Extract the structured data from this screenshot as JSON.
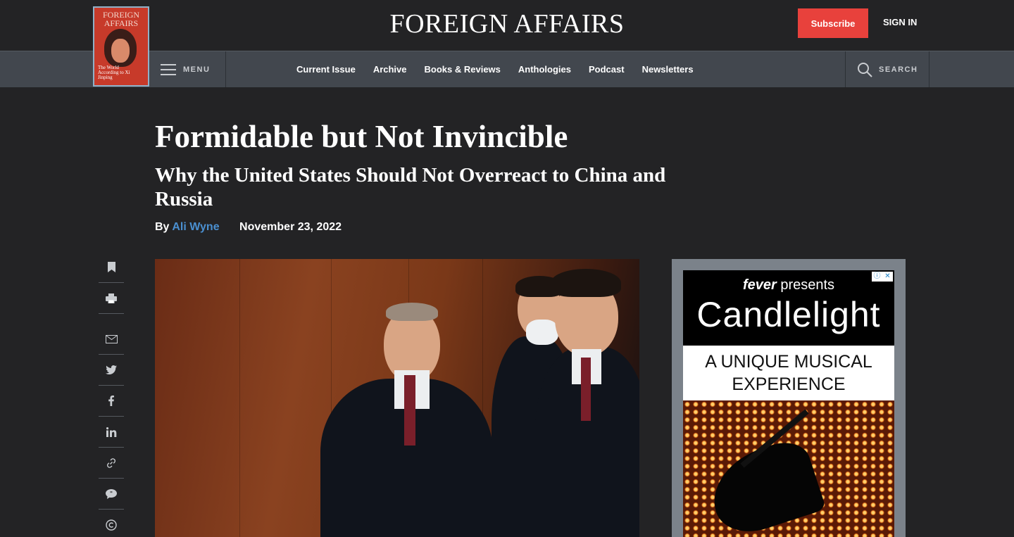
{
  "header": {
    "logo": "FOREIGN AFFAIRS",
    "subscribe_label": "Subscribe",
    "signin_label": "SIGN IN"
  },
  "cover": {
    "title_line1": "FOREIGN",
    "title_line2": "AFFAIRS",
    "subtitle": "The World According to Xi Jinping"
  },
  "nav": {
    "menu_label": "MENU",
    "links": [
      "Current Issue",
      "Archive",
      "Books & Reviews",
      "Anthologies",
      "Podcast",
      "Newsletters"
    ],
    "search_label": "SEARCH"
  },
  "article": {
    "title": "Formidable but Not Invincible",
    "subtitle": "Why the United States Should Not Overreact to China and Russia",
    "by": "By",
    "author": "Ali Wyne",
    "date": "November 23, 2022"
  },
  "share_rail": {
    "icons": [
      "bookmark-icon",
      "print-icon",
      "email-icon",
      "twitter-icon",
      "facebook-icon",
      "linkedin-icon",
      "link-icon",
      "comment-icon",
      "copyright-icon"
    ]
  },
  "ad": {
    "brand": "fever",
    "presents": "presents",
    "headline": "Candlelight",
    "tagline_line1": "A UNIQUE MUSICAL",
    "tagline_line2": "EXPERIENCE",
    "info_glyph": "ⓘ",
    "close_glyph": "✕"
  },
  "colors": {
    "background": "#232325",
    "nav_background": "#42474e",
    "subscribe": "#e8413c",
    "author_link": "#4a8fd0"
  }
}
